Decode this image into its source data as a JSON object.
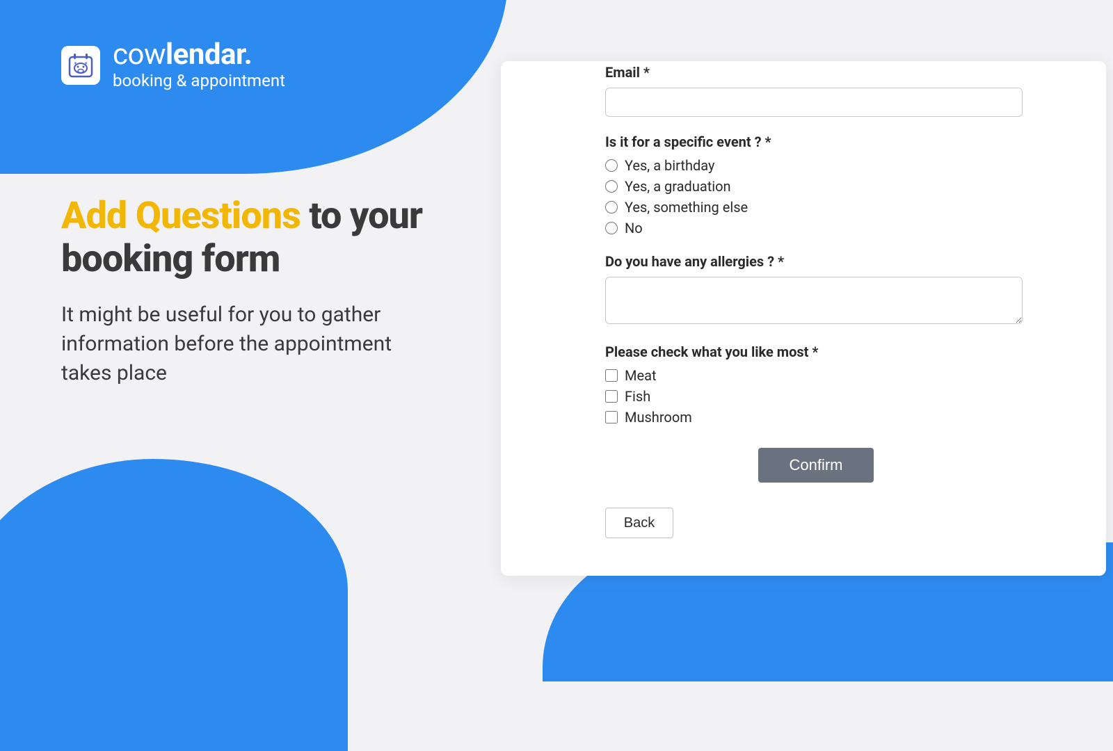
{
  "brand": {
    "name_prefix": "cow",
    "name_suffix": "lendar.",
    "tagline": "booking & appointment"
  },
  "hero": {
    "title_accent": "Add Questions",
    "title_rest": " to your booking form",
    "subtitle": "It might be useful for you to gather information before the appointment takes place"
  },
  "form": {
    "email_label": "Email *",
    "event_label": "Is it for a specific event ? *",
    "event_options": {
      "o1": "Yes, a birthday",
      "o2": "Yes, a graduation",
      "o3": "Yes, something else",
      "o4": "No"
    },
    "allergies_label": "Do you have any allergies ? *",
    "likes_label": "Please check what you like most *",
    "likes_options": {
      "c1": "Meat",
      "c2": "Fish",
      "c3": "Mushroom"
    },
    "confirm": "Confirm",
    "back": "Back"
  }
}
